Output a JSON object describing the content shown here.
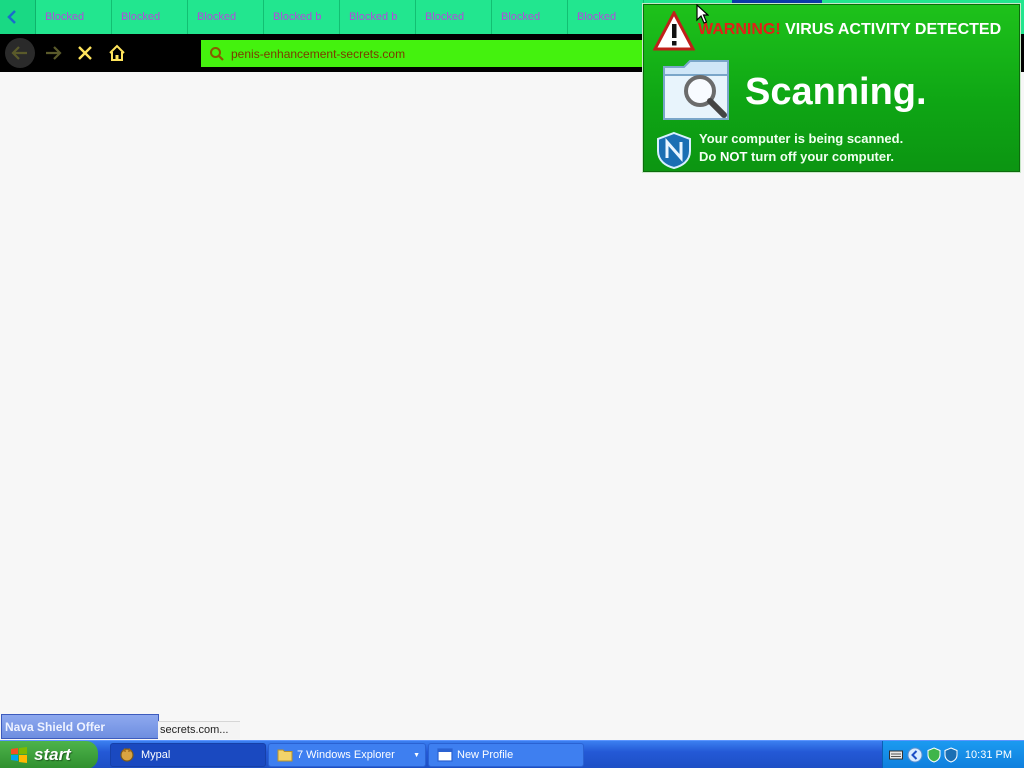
{
  "browser": {
    "tabs": [
      "Blocked",
      "Blocked",
      "Blocked",
      "Blocked b",
      "Blocked b",
      "Blocked",
      "Blocked",
      "Blocked"
    ],
    "url": "penis-enhancement-secrets.com",
    "status_text": "secrets.com..."
  },
  "popup": {
    "warning_red": "WARNING!",
    "warning_white": "VIRUS ACTIVITY DETECTED",
    "scanning": "Scanning.",
    "line1": "Your computer is being scanned.",
    "line2_pre": "Do",
    "line2_strong": "NOT",
    "line2_post": "turn off your computer."
  },
  "offer": {
    "label": "Nava Shield Offer"
  },
  "taskbar": {
    "start_label": "start",
    "tasks": [
      {
        "label": "Mypal"
      },
      {
        "label": "7 Windows Explorer"
      },
      {
        "label": "New Profile"
      }
    ],
    "clock": "10:31 PM"
  },
  "colors": {
    "tab_green": "#22e68f",
    "url_green": "#44f20e",
    "popup_green": "#0ea514",
    "warning_red": "#e02218",
    "taskbar_blue": "#2459d6"
  }
}
